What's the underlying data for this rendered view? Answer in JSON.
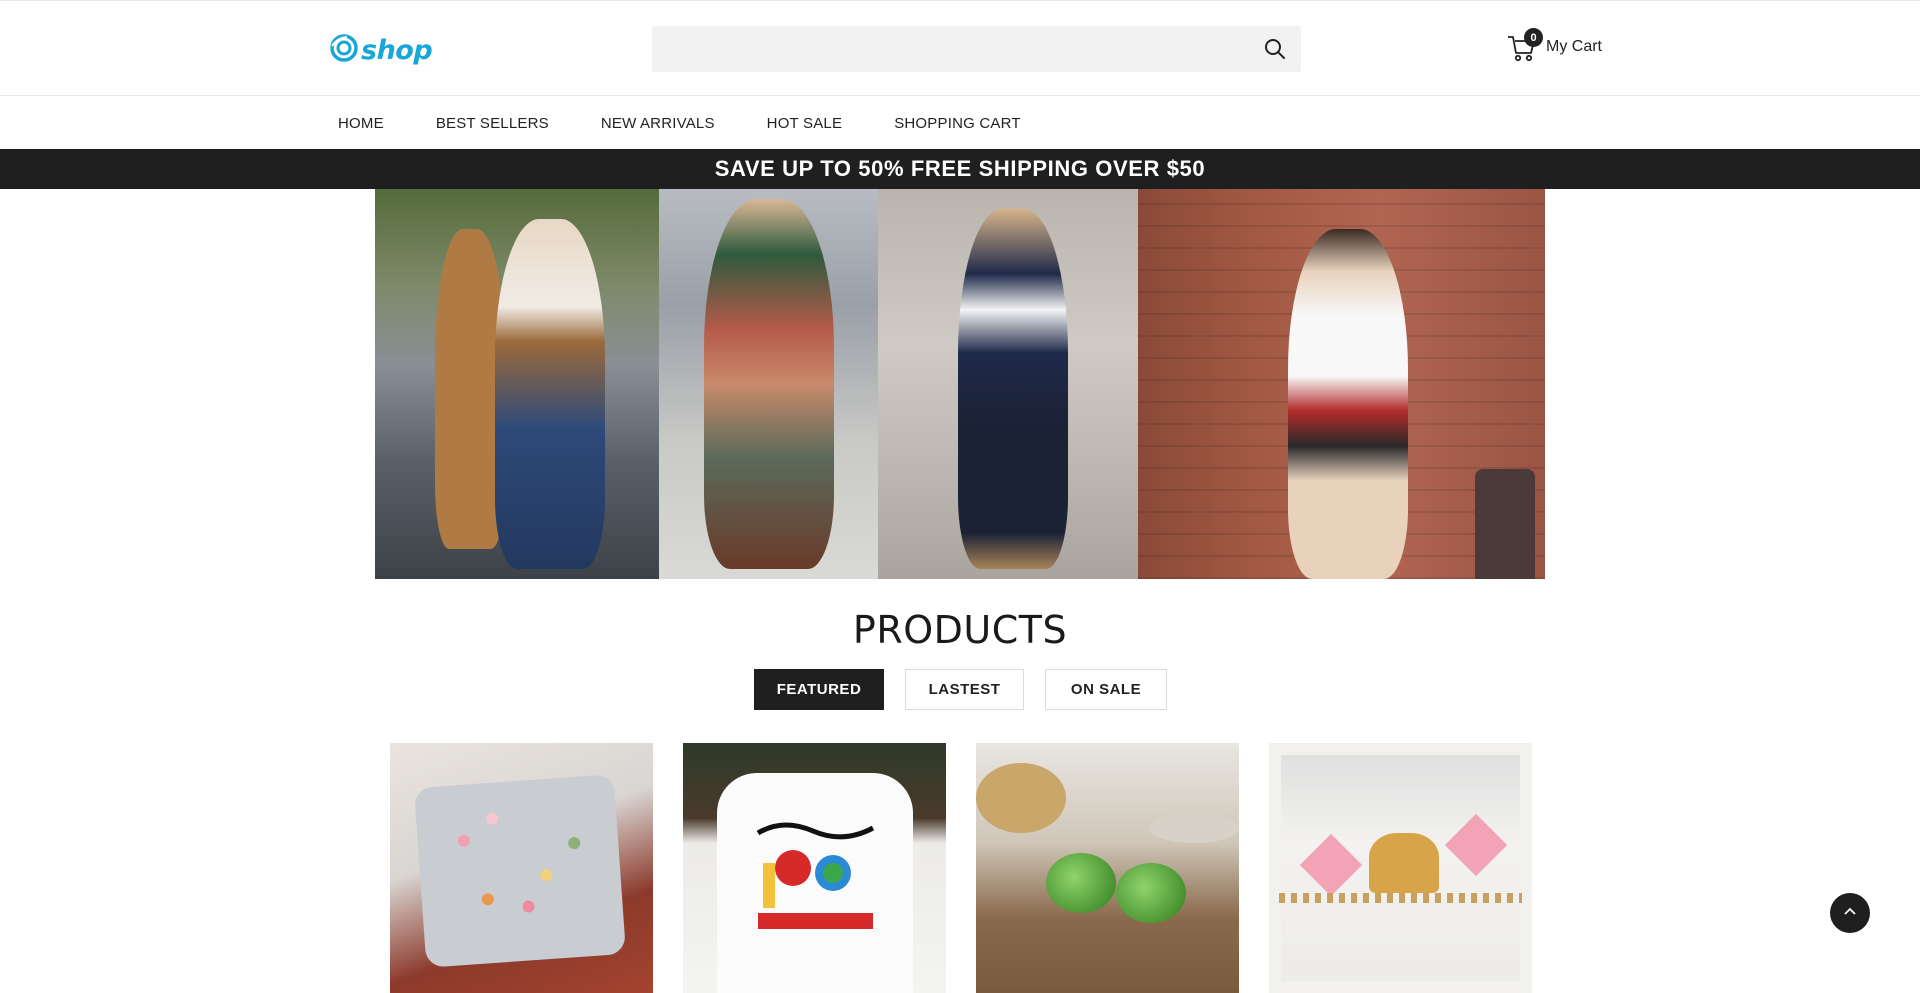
{
  "header": {
    "logo_text": "shop",
    "search": {
      "placeholder": "",
      "value": ""
    },
    "cart": {
      "count": "0",
      "label": "My Cart"
    }
  },
  "nav": {
    "items": [
      {
        "label": "HOME"
      },
      {
        "label": "BEST SELLERS"
      },
      {
        "label": "NEW ARRIVALS"
      },
      {
        "label": "HOT SALE"
      },
      {
        "label": "SHOPPING CART"
      }
    ]
  },
  "announcement": {
    "text": "SAVE UP TO 50% FREE SHIPPING OVER $50"
  },
  "products": {
    "title": "PRODUCTS",
    "tabs": [
      {
        "label": "FEATURED",
        "active": true
      },
      {
        "label": "LASTEST",
        "active": false
      },
      {
        "label": "ON SALE",
        "active": false
      }
    ]
  },
  "colors": {
    "brand": "#19a6d8",
    "dark": "#1f1f1f",
    "search_bg": "#f2f2f2"
  },
  "icons": {
    "logo": "swirl-logo-icon",
    "search": "search-icon",
    "cart": "cart-icon",
    "back_to_top": "chevron-up-icon"
  }
}
